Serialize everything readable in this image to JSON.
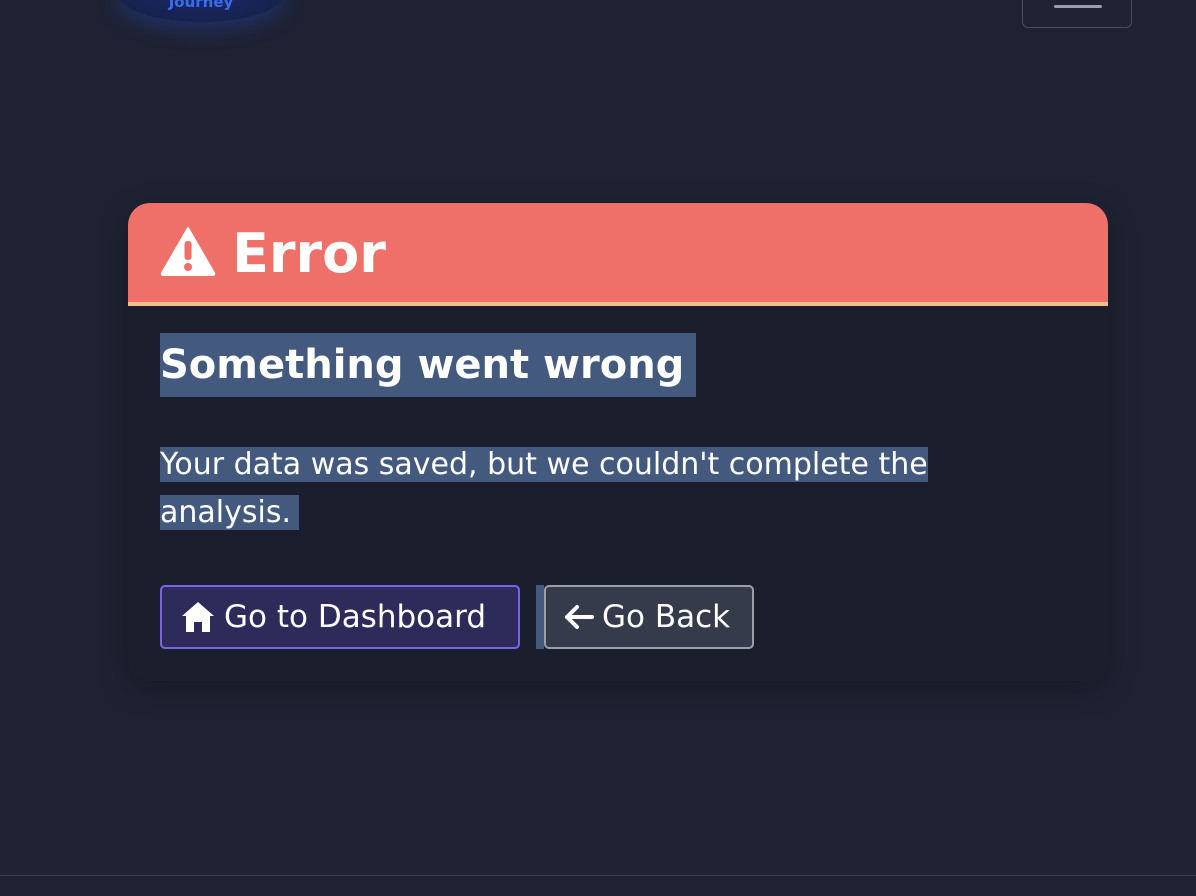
{
  "nav": {
    "logo_text": "Journey",
    "menu_icon": "hamburger-icon"
  },
  "error_card": {
    "header_icon": "warning-icon",
    "header_title": "Error",
    "headline": "Something went wrong",
    "message": "Your data was saved, but we couldn't complete the analysis.",
    "buttons": {
      "dashboard": {
        "label": "Go to Dashboard",
        "icon": "home-icon"
      },
      "back": {
        "label": "Go Back",
        "icon": "arrow-left-icon"
      }
    }
  },
  "colors": {
    "page_bg": "#1e2232",
    "header_bg": "#ee7069",
    "header_accent": "#f0c08a",
    "selection": "#435a7e",
    "primary_border": "#7a63e6"
  }
}
